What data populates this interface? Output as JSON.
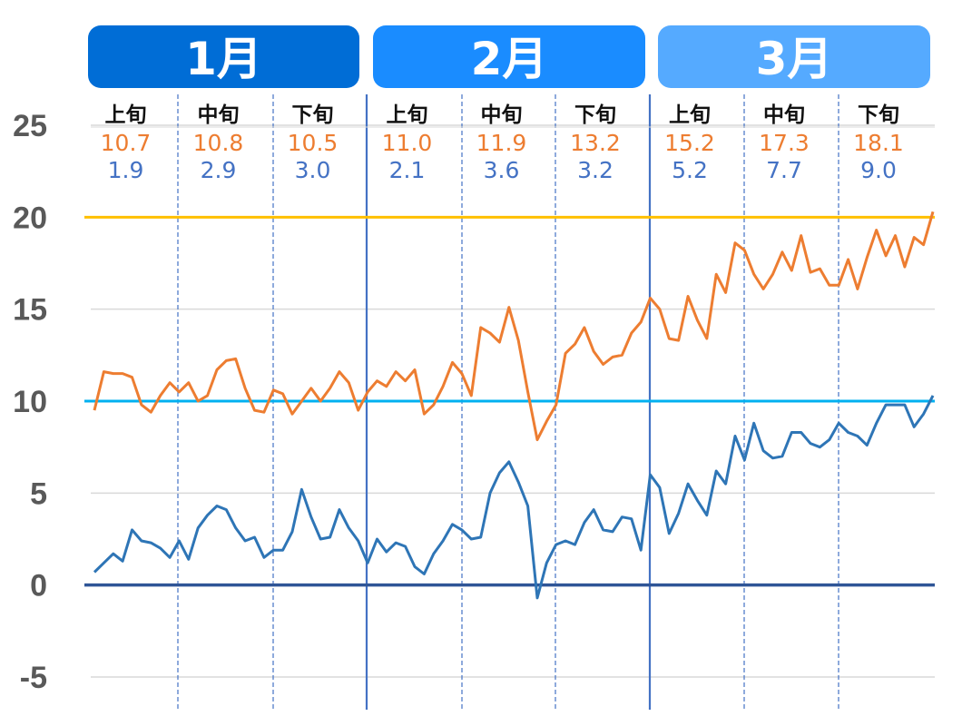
{
  "chart_data": {
    "type": "line",
    "title": "",
    "xlabel": "",
    "ylabel": "",
    "ylim": [
      -5,
      25
    ],
    "yticks": [
      25,
      20,
      15,
      10,
      5,
      0,
      -5
    ],
    "grid": true,
    "legend": "none",
    "months": [
      {
        "label": "1月",
        "color": "#006dd6",
        "days": 31
      },
      {
        "label": "2月",
        "color": "#1a8cff",
        "days": 28
      },
      {
        "label": "3月",
        "color": "#55aaff",
        "days": 31
      }
    ],
    "periods": [
      {
        "label": "上旬",
        "avg_high": "10.7",
        "avg_low": "1.9"
      },
      {
        "label": "中旬",
        "avg_high": "10.8",
        "avg_low": "2.9"
      },
      {
        "label": "下旬",
        "avg_high": "10.5",
        "avg_low": "3.0"
      },
      {
        "label": "上旬",
        "avg_high": "11.0",
        "avg_low": "2.1"
      },
      {
        "label": "中旬",
        "avg_high": "11.9",
        "avg_low": "3.6"
      },
      {
        "label": "下旬",
        "avg_high": "13.2",
        "avg_low": "3.2"
      },
      {
        "label": "上旬",
        "avg_high": "15.2",
        "avg_low": "5.2"
      },
      {
        "label": "中旬",
        "avg_high": "17.3",
        "avg_low": "7.7"
      },
      {
        "label": "下旬",
        "avg_high": "18.1",
        "avg_low": "9.0"
      }
    ],
    "reference_lines": [
      {
        "name": "20-degree-line",
        "value": 20,
        "color": "#ffc000"
      },
      {
        "name": "10-degree-line",
        "value": 10,
        "color": "#00b0f0"
      },
      {
        "name": "0-degree-line",
        "value": 0,
        "color": "#2f5597"
      }
    ],
    "series": [
      {
        "name": "daily-high",
        "color": "#ed7d31",
        "values": [
          9.5,
          11.6,
          11.5,
          11.5,
          11.3,
          9.8,
          9.4,
          10.3,
          11.0,
          10.5,
          11.0,
          10.0,
          10.3,
          11.7,
          12.2,
          12.3,
          10.7,
          9.5,
          9.4,
          10.6,
          10.4,
          9.3,
          10.0,
          10.7,
          10.0,
          10.7,
          11.6,
          11.0,
          9.5,
          10.5,
          11.1,
          10.8,
          11.6,
          11.1,
          11.7,
          9.3,
          9.8,
          10.8,
          12.1,
          11.5,
          10.3,
          14.0,
          13.7,
          13.2,
          15.1,
          13.3,
          10.5,
          7.9,
          8.9,
          9.8,
          12.6,
          13.1,
          14.0,
          12.7,
          12.0,
          12.4,
          12.5,
          13.7,
          14.3,
          15.6,
          15.0,
          13.4,
          13.3,
          15.7,
          14.4,
          13.4,
          16.9,
          15.9,
          18.6,
          18.2,
          16.9,
          16.1,
          16.9,
          18.1,
          17.1,
          19.0,
          17.0,
          17.2,
          16.3,
          16.3,
          17.7,
          16.1,
          17.8,
          19.3,
          17.9,
          19.0,
          17.3,
          18.9,
          18.5,
          20.3
        ]
      },
      {
        "name": "daily-low",
        "color": "#2e75b6",
        "values": [
          0.7,
          1.2,
          1.7,
          1.3,
          3.0,
          2.4,
          2.3,
          2.0,
          1.5,
          2.4,
          1.4,
          3.1,
          3.8,
          4.3,
          4.1,
          3.1,
          2.4,
          2.6,
          1.5,
          1.9,
          1.9,
          2.9,
          5.2,
          3.7,
          2.5,
          2.6,
          4.1,
          3.1,
          2.4,
          1.2,
          2.5,
          1.8,
          2.3,
          2.1,
          1.0,
          0.6,
          1.7,
          2.4,
          3.3,
          3.0,
          2.5,
          2.6,
          5.0,
          6.1,
          6.7,
          5.6,
          4.3,
          -0.7,
          1.2,
          2.2,
          2.4,
          2.2,
          3.4,
          4.1,
          3.0,
          2.9,
          3.7,
          3.6,
          1.9,
          6.0,
          5.3,
          2.8,
          3.9,
          5.5,
          4.6,
          3.8,
          6.2,
          5.5,
          8.1,
          6.8,
          8.8,
          7.3,
          6.9,
          7.0,
          8.3,
          8.3,
          7.7,
          7.5,
          7.9,
          8.8,
          8.3,
          8.1,
          7.6,
          8.8,
          9.8,
          9.8,
          9.8,
          8.6,
          9.3,
          10.3
        ]
      }
    ]
  }
}
